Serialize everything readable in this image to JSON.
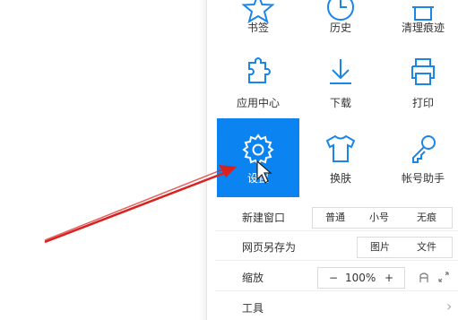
{
  "tiles_top": [
    {
      "label": "书签",
      "icon": "star-icon"
    },
    {
      "label": "历史",
      "icon": "history-icon"
    },
    {
      "label": "清理痕迹",
      "icon": "clean-icon"
    }
  ],
  "tiles_mid": [
    {
      "label": "应用中心",
      "icon": "puzzle-icon"
    },
    {
      "label": "下载",
      "icon": "download-icon"
    },
    {
      "label": "打印",
      "icon": "printer-icon"
    }
  ],
  "tiles_low": [
    {
      "label": "设置",
      "icon": "gear-icon"
    },
    {
      "label": "换肤",
      "icon": "shirt-icon"
    },
    {
      "label": "帐号助手",
      "icon": "key-icon"
    }
  ],
  "new_window": {
    "label": "新建窗口",
    "options": [
      "普通",
      "小号",
      "无痕"
    ]
  },
  "save_as": {
    "label": "网页另存为",
    "options": [
      "图片",
      "文件"
    ]
  },
  "zoom": {
    "label": "缩放",
    "minus": "−",
    "value": "100%",
    "plus": "+"
  },
  "tools": {
    "label": "工具",
    "chevron": "›"
  },
  "colors": {
    "accent": "#0b83f0",
    "arrow": "#d9211e",
    "icon_blue": "#1a86e8"
  }
}
